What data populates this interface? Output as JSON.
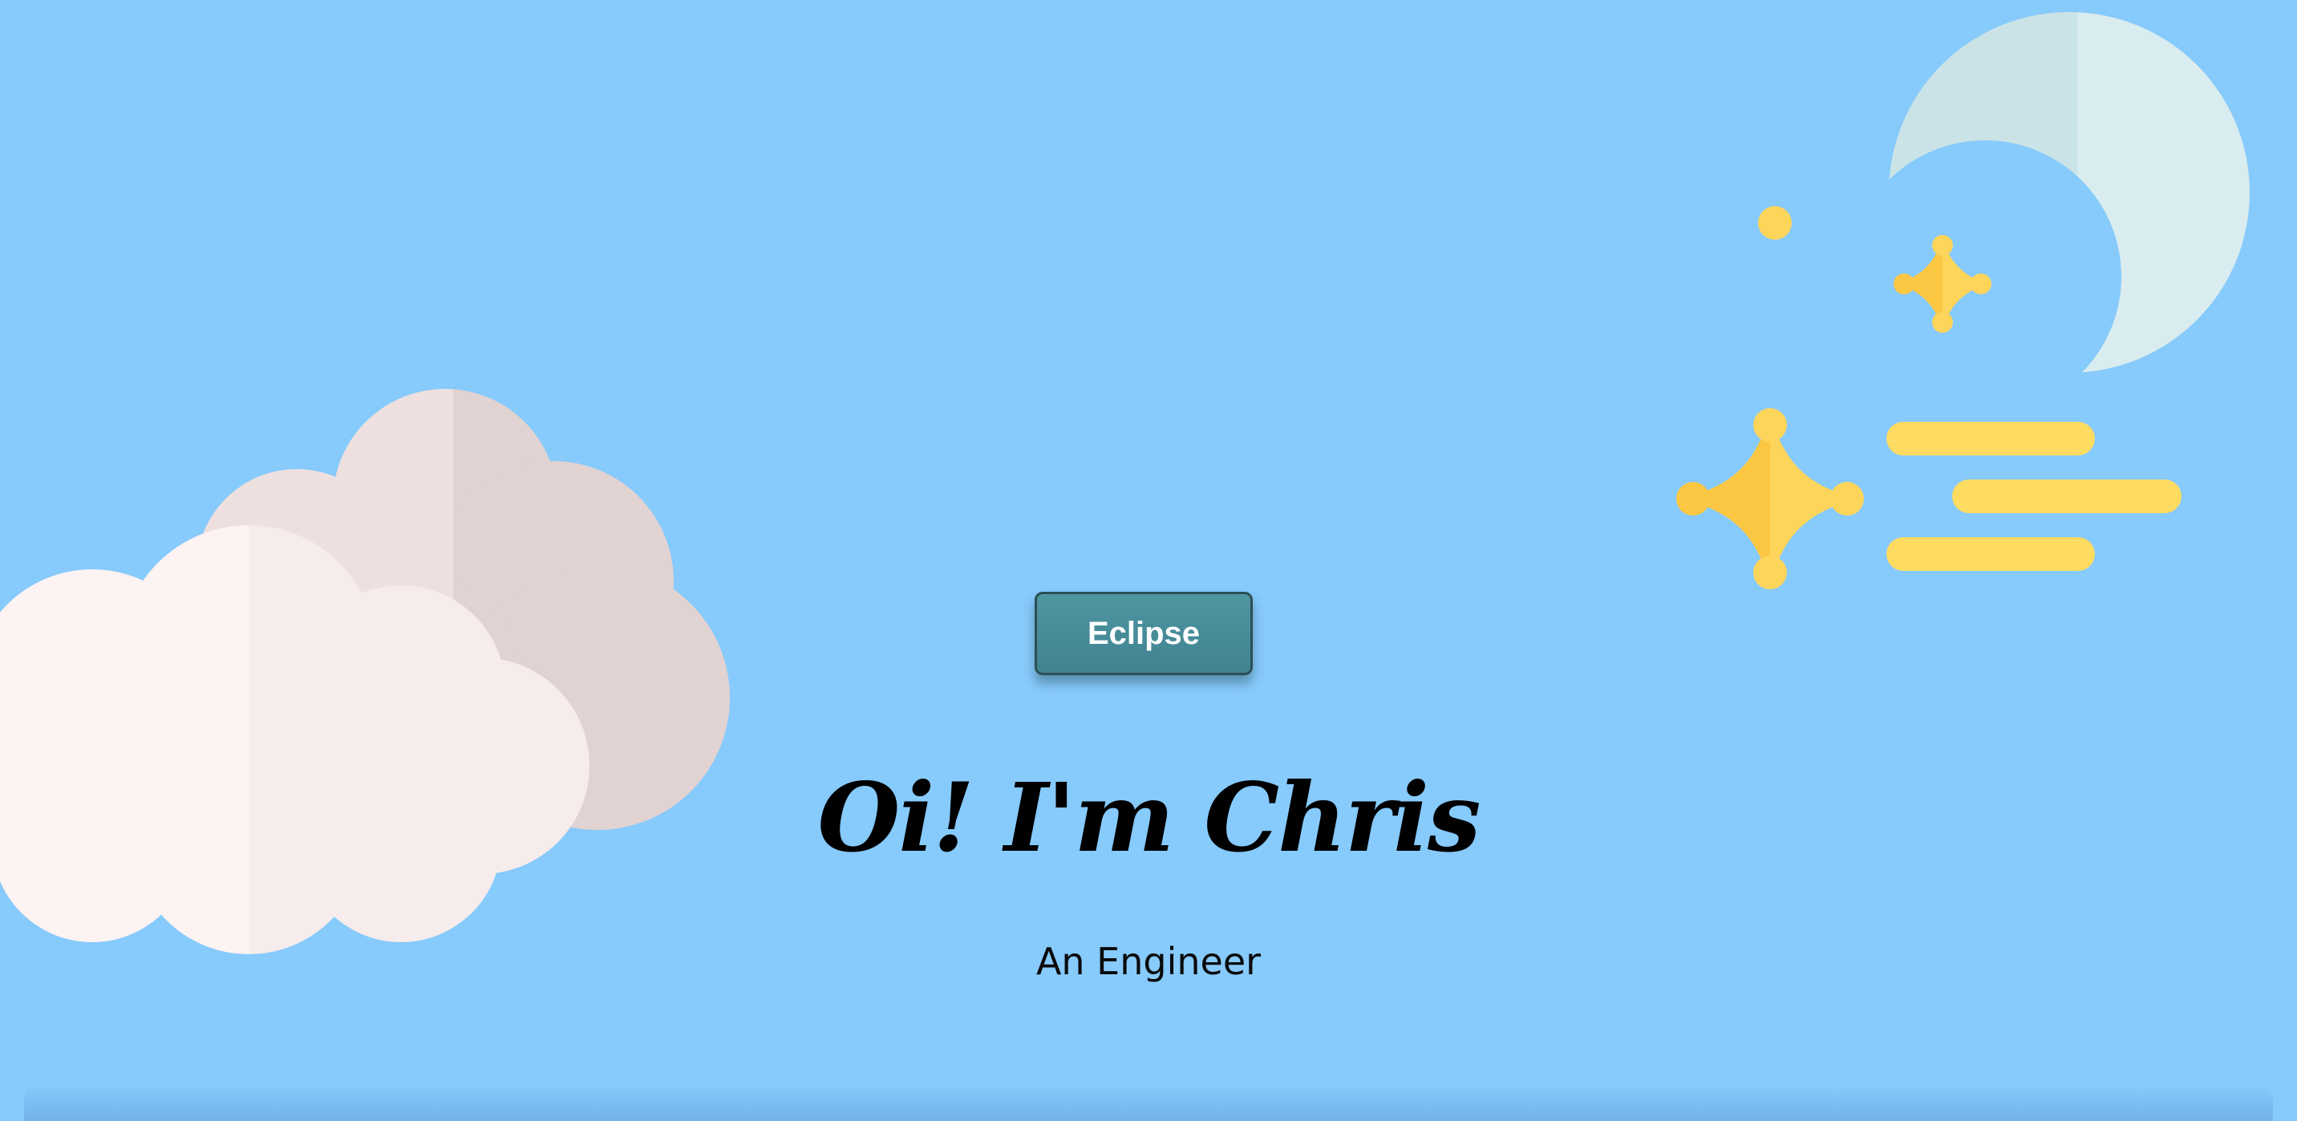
{
  "theme_toggle": {
    "label": "Eclipse"
  },
  "hero": {
    "title": "Oi! I'm Chris",
    "subtitle": "An Engineer"
  },
  "icons": {
    "clouds": "cloud-icon",
    "night": "moon-stars-icon"
  },
  "colors": {
    "sky": "#87cafc",
    "button": "#4a8e99",
    "star": "#fdd55a",
    "moon": "#d6ebee",
    "cloud_front": "#fdf2f1",
    "cloud_back": "#e6d8d8"
  }
}
